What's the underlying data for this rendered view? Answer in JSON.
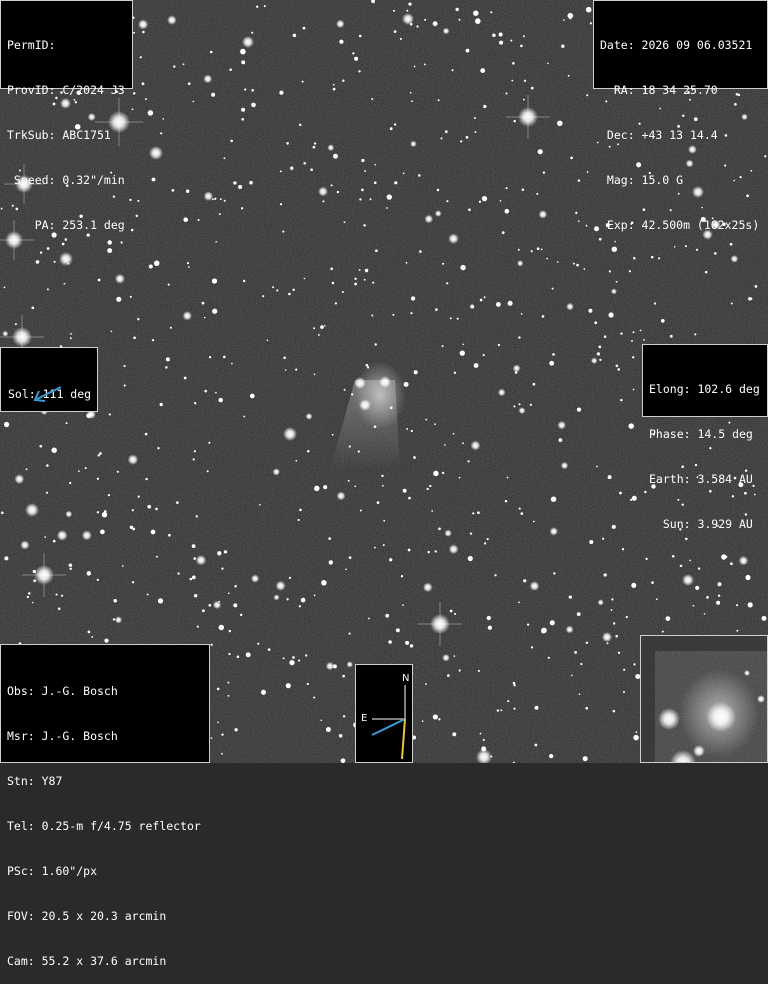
{
  "header_left": {
    "perm_id": "PermID:",
    "prov_id": "ProvID: C/2024 J3",
    "trk_sub": "TrkSub: ABC1751",
    "speed": " Speed: 0.32\"/min",
    "pa": "    PA: 253.1 deg"
  },
  "header_right": {
    "date": "Date: 2026 09 06.03521",
    "ra": "  RA: 18 34 25.70",
    "dec": " Dec: +43 13 14.4",
    "mag": " Mag: 15.0 G",
    "exp": " Exp: 42.500m (102x25s)"
  },
  "solar": {
    "label": "Sol: 111 deg",
    "arrow_color": "#3a9ad8"
  },
  "geometry": {
    "elong": "Elong: 102.6 deg",
    "phase": "Phase: 14.5 deg",
    "earth": "Earth: 3.584 AU",
    "sun": "  Sun: 3.929 AU"
  },
  "observer": {
    "obs": "Obs: J.-G. Bosch",
    "msr": "Msr: J.-G. Bosch",
    "stn": "Stn: Y87",
    "tel": "Tel: 0.25-m f/4.75 reflector",
    "psc": "PSc: 1.60\"/px",
    "fov": "FOV: 20.5 x 20.3 arcmin",
    "cam": "Cam: 55.2 x 37.6 arcmin"
  },
  "compass": {
    "north_label": "N",
    "east_label": "E",
    "north_color": "#ffffff",
    "east_color": "#ffffff",
    "motion_color": "#3a9ad8",
    "sun_color": "#e8c547"
  },
  "image": {
    "background_color": "#2a2a2a",
    "star_color": "#ffffff",
    "comet_color": "#ffffff"
  }
}
